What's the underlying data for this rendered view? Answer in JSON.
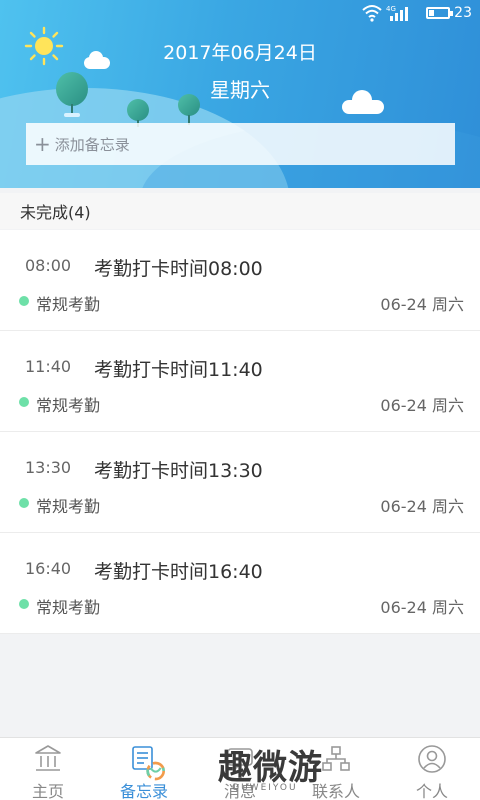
{
  "status": {
    "battery_level": "23"
  },
  "header": {
    "date": "2017年06月24日",
    "weekday": "星期六",
    "add_placeholder": "添加备忘录",
    "add_icon": "plus-icon"
  },
  "section": {
    "title": "未完成(4)"
  },
  "memos": [
    {
      "time": "08:00",
      "title": "考勤打卡时间08:00",
      "category": "常规考勤",
      "date": "06-24 周六"
    },
    {
      "time": "11:40",
      "title": "考勤打卡时间11:40",
      "category": "常规考勤",
      "date": "06-24 周六"
    },
    {
      "time": "13:30",
      "title": "考勤打卡时间13:30",
      "category": "常规考勤",
      "date": "06-24 周六"
    },
    {
      "time": "16:40",
      "title": "考勤打卡时间16:40",
      "category": "常规考勤",
      "date": "06-24 周六"
    }
  ],
  "nav": [
    {
      "label": "主页",
      "icon": "bank-icon"
    },
    {
      "label": "备忘录",
      "icon": "memo-icon",
      "active": true
    },
    {
      "label": "消息",
      "icon": "message-icon"
    },
    {
      "label": "联系人",
      "icon": "org-chart-icon"
    },
    {
      "label": "个人",
      "icon": "user-icon"
    }
  ],
  "watermark": {
    "text": "趣微游",
    "sub": "QUWEIYOU"
  },
  "colors": {
    "accent": "#3a8fd8",
    "dot": "#6ee0a8",
    "header_start": "#4fc2ef",
    "header_end": "#2f8fd8"
  }
}
